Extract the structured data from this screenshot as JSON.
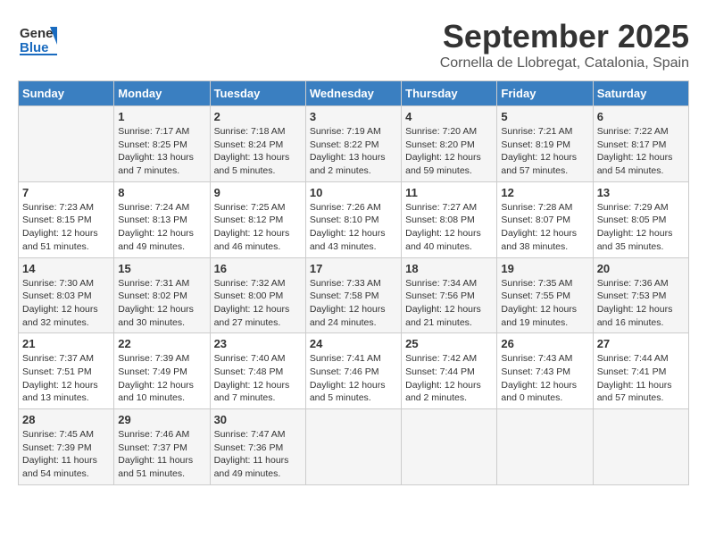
{
  "header": {
    "logo_general": "General",
    "logo_blue": "Blue",
    "title": "September 2025",
    "subtitle": "Cornella de Llobregat, Catalonia, Spain"
  },
  "days_of_week": [
    "Sunday",
    "Monday",
    "Tuesday",
    "Wednesday",
    "Thursday",
    "Friday",
    "Saturday"
  ],
  "weeks": [
    [
      {
        "day": "",
        "details": []
      },
      {
        "day": "1",
        "details": [
          "Sunrise: 7:17 AM",
          "Sunset: 8:25 PM",
          "Daylight: 13 hours",
          "and 7 minutes."
        ]
      },
      {
        "day": "2",
        "details": [
          "Sunrise: 7:18 AM",
          "Sunset: 8:24 PM",
          "Daylight: 13 hours",
          "and 5 minutes."
        ]
      },
      {
        "day": "3",
        "details": [
          "Sunrise: 7:19 AM",
          "Sunset: 8:22 PM",
          "Daylight: 13 hours",
          "and 2 minutes."
        ]
      },
      {
        "day": "4",
        "details": [
          "Sunrise: 7:20 AM",
          "Sunset: 8:20 PM",
          "Daylight: 12 hours",
          "and 59 minutes."
        ]
      },
      {
        "day": "5",
        "details": [
          "Sunrise: 7:21 AM",
          "Sunset: 8:19 PM",
          "Daylight: 12 hours",
          "and 57 minutes."
        ]
      },
      {
        "day": "6",
        "details": [
          "Sunrise: 7:22 AM",
          "Sunset: 8:17 PM",
          "Daylight: 12 hours",
          "and 54 minutes."
        ]
      }
    ],
    [
      {
        "day": "7",
        "details": [
          "Sunrise: 7:23 AM",
          "Sunset: 8:15 PM",
          "Daylight: 12 hours",
          "and 51 minutes."
        ]
      },
      {
        "day": "8",
        "details": [
          "Sunrise: 7:24 AM",
          "Sunset: 8:13 PM",
          "Daylight: 12 hours",
          "and 49 minutes."
        ]
      },
      {
        "day": "9",
        "details": [
          "Sunrise: 7:25 AM",
          "Sunset: 8:12 PM",
          "Daylight: 12 hours",
          "and 46 minutes."
        ]
      },
      {
        "day": "10",
        "details": [
          "Sunrise: 7:26 AM",
          "Sunset: 8:10 PM",
          "Daylight: 12 hours",
          "and 43 minutes."
        ]
      },
      {
        "day": "11",
        "details": [
          "Sunrise: 7:27 AM",
          "Sunset: 8:08 PM",
          "Daylight: 12 hours",
          "and 40 minutes."
        ]
      },
      {
        "day": "12",
        "details": [
          "Sunrise: 7:28 AM",
          "Sunset: 8:07 PM",
          "Daylight: 12 hours",
          "and 38 minutes."
        ]
      },
      {
        "day": "13",
        "details": [
          "Sunrise: 7:29 AM",
          "Sunset: 8:05 PM",
          "Daylight: 12 hours",
          "and 35 minutes."
        ]
      }
    ],
    [
      {
        "day": "14",
        "details": [
          "Sunrise: 7:30 AM",
          "Sunset: 8:03 PM",
          "Daylight: 12 hours",
          "and 32 minutes."
        ]
      },
      {
        "day": "15",
        "details": [
          "Sunrise: 7:31 AM",
          "Sunset: 8:02 PM",
          "Daylight: 12 hours",
          "and 30 minutes."
        ]
      },
      {
        "day": "16",
        "details": [
          "Sunrise: 7:32 AM",
          "Sunset: 8:00 PM",
          "Daylight: 12 hours",
          "and 27 minutes."
        ]
      },
      {
        "day": "17",
        "details": [
          "Sunrise: 7:33 AM",
          "Sunset: 7:58 PM",
          "Daylight: 12 hours",
          "and 24 minutes."
        ]
      },
      {
        "day": "18",
        "details": [
          "Sunrise: 7:34 AM",
          "Sunset: 7:56 PM",
          "Daylight: 12 hours",
          "and 21 minutes."
        ]
      },
      {
        "day": "19",
        "details": [
          "Sunrise: 7:35 AM",
          "Sunset: 7:55 PM",
          "Daylight: 12 hours",
          "and 19 minutes."
        ]
      },
      {
        "day": "20",
        "details": [
          "Sunrise: 7:36 AM",
          "Sunset: 7:53 PM",
          "Daylight: 12 hours",
          "and 16 minutes."
        ]
      }
    ],
    [
      {
        "day": "21",
        "details": [
          "Sunrise: 7:37 AM",
          "Sunset: 7:51 PM",
          "Daylight: 12 hours",
          "and 13 minutes."
        ]
      },
      {
        "day": "22",
        "details": [
          "Sunrise: 7:39 AM",
          "Sunset: 7:49 PM",
          "Daylight: 12 hours",
          "and 10 minutes."
        ]
      },
      {
        "day": "23",
        "details": [
          "Sunrise: 7:40 AM",
          "Sunset: 7:48 PM",
          "Daylight: 12 hours",
          "and 7 minutes."
        ]
      },
      {
        "day": "24",
        "details": [
          "Sunrise: 7:41 AM",
          "Sunset: 7:46 PM",
          "Daylight: 12 hours",
          "and 5 minutes."
        ]
      },
      {
        "day": "25",
        "details": [
          "Sunrise: 7:42 AM",
          "Sunset: 7:44 PM",
          "Daylight: 12 hours",
          "and 2 minutes."
        ]
      },
      {
        "day": "26",
        "details": [
          "Sunrise: 7:43 AM",
          "Sunset: 7:43 PM",
          "Daylight: 12 hours",
          "and 0 minutes."
        ]
      },
      {
        "day": "27",
        "details": [
          "Sunrise: 7:44 AM",
          "Sunset: 7:41 PM",
          "Daylight: 11 hours",
          "and 57 minutes."
        ]
      }
    ],
    [
      {
        "day": "28",
        "details": [
          "Sunrise: 7:45 AM",
          "Sunset: 7:39 PM",
          "Daylight: 11 hours",
          "and 54 minutes."
        ]
      },
      {
        "day": "29",
        "details": [
          "Sunrise: 7:46 AM",
          "Sunset: 7:37 PM",
          "Daylight: 11 hours",
          "and 51 minutes."
        ]
      },
      {
        "day": "30",
        "details": [
          "Sunrise: 7:47 AM",
          "Sunset: 7:36 PM",
          "Daylight: 11 hours",
          "and 49 minutes."
        ]
      },
      {
        "day": "",
        "details": []
      },
      {
        "day": "",
        "details": []
      },
      {
        "day": "",
        "details": []
      },
      {
        "day": "",
        "details": []
      }
    ]
  ]
}
